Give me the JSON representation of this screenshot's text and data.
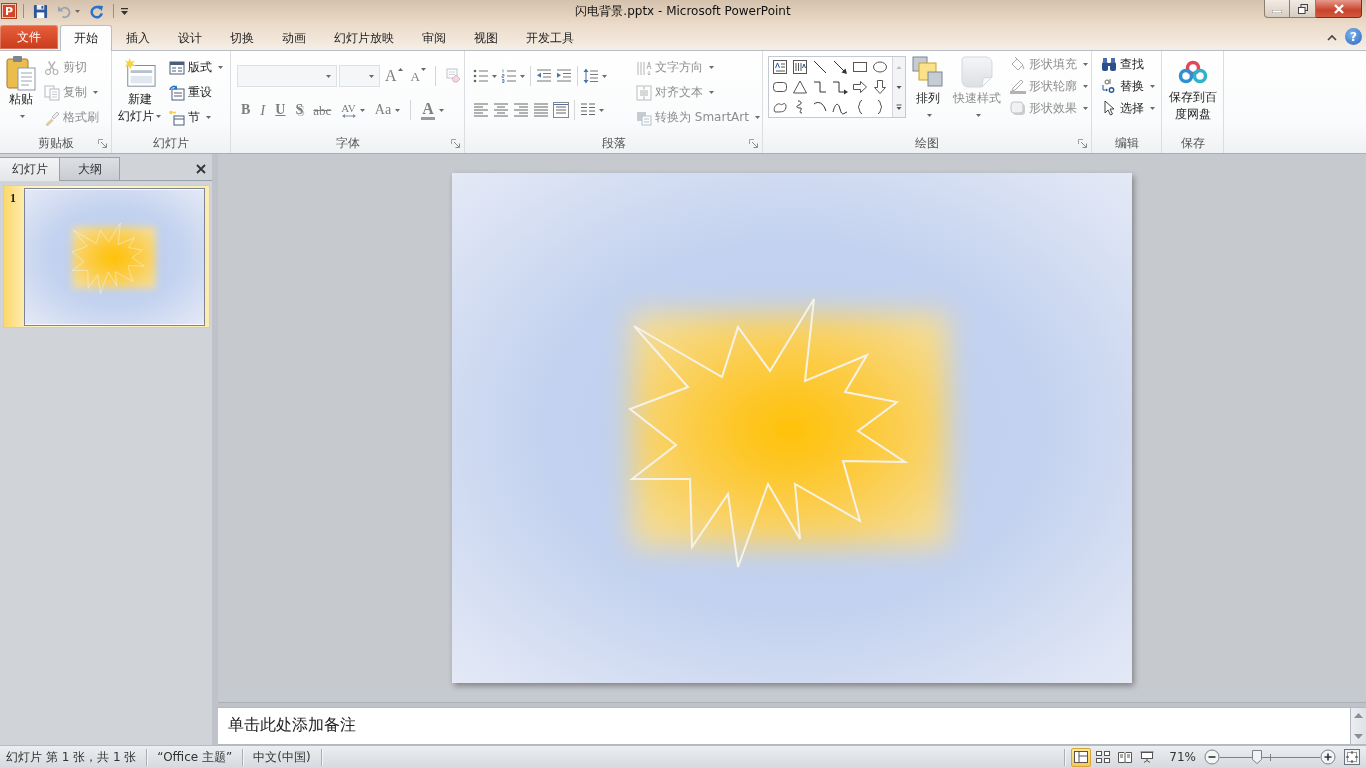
{
  "window": {
    "logo": "P",
    "title": "闪电背景.pptx - Microsoft PowerPoint",
    "help": "?"
  },
  "tabs": [
    {
      "label": "文件",
      "kind": "backstage",
      "selected": false
    },
    {
      "label": "开始",
      "kind": "tab",
      "selected": true
    },
    {
      "label": "插入",
      "kind": "tab",
      "selected": false
    },
    {
      "label": "设计",
      "kind": "tab",
      "selected": false
    },
    {
      "label": "切换",
      "kind": "tab",
      "selected": false
    },
    {
      "label": "动画",
      "kind": "tab",
      "selected": false
    },
    {
      "label": "幻灯片放映",
      "kind": "tab",
      "selected": false
    },
    {
      "label": "审阅",
      "kind": "tab",
      "selected": false
    },
    {
      "label": "视图",
      "kind": "tab",
      "selected": false
    },
    {
      "label": "开发工具",
      "kind": "tab",
      "selected": false
    }
  ],
  "ribbon": [
    {
      "label": "剪贴板",
      "launcher": true,
      "commands": [
        {
          "label": "粘贴",
          "disabled": false
        },
        {
          "label": "剪切",
          "disabled": true
        },
        {
          "label": "复制",
          "disabled": true
        },
        {
          "label": "格式刷",
          "disabled": true
        }
      ]
    },
    {
      "label": "幻灯片",
      "commands": [
        {
          "label": "新建",
          "label_2": "幻灯片",
          "disabled": false
        },
        {
          "label": "版式",
          "disabled": false
        },
        {
          "label": "重设",
          "disabled": false
        },
        {
          "label": "节",
          "disabled": false
        }
      ]
    },
    {
      "label": "字体",
      "launcher": true,
      "fields": [
        {
          "disabled": true
        },
        {
          "disabled": true
        }
      ],
      "commands": [
        {
          "label": "A",
          "kind": "grow",
          "disabled": true
        },
        {
          "label": "A",
          "kind": "shrink",
          "disabled": true
        },
        {
          "kind": "clear",
          "disabled": true
        },
        {
          "label": "B",
          "kind": "bold",
          "disabled": true
        },
        {
          "label": "I",
          "kind": "italic",
          "disabled": true
        },
        {
          "label": "U",
          "kind": "underline",
          "disabled": true
        },
        {
          "label": "S",
          "kind": "shadow",
          "disabled": true
        },
        {
          "label": "abc",
          "kind": "strike",
          "disabled": true
        },
        {
          "label": "AV",
          "kind": "spacing",
          "disabled": true
        },
        {
          "label": "Aa",
          "kind": "case",
          "disabled": true
        },
        {
          "label": "A",
          "kind": "color",
          "disabled": true
        }
      ]
    },
    {
      "label": "段落",
      "launcher": true,
      "commands": [
        {
          "label": "文字方向",
          "disabled": true
        },
        {
          "label": "对齐文本",
          "disabled": true
        },
        {
          "label": "转换为 SmartArt",
          "disabled": true
        }
      ]
    },
    {
      "label": "绘图",
      "launcher": true,
      "commands": [
        {
          "label": "排列",
          "disabled": false
        },
        {
          "label": "快速样式",
          "disabled": true
        },
        {
          "label": "形状填充",
          "disabled": true
        },
        {
          "label": "形状轮廓",
          "disabled": true
        },
        {
          "label": "形状效果",
          "disabled": true
        }
      ]
    },
    {
      "label": "编辑",
      "commands": [
        {
          "label": "查找",
          "disabled": false
        },
        {
          "label": "替换",
          "disabled": false
        },
        {
          "label": "选择",
          "disabled": false
        }
      ]
    },
    {
      "label": "保存",
      "commands": [
        {
          "label": "保存到百度网盘",
          "disabled": false
        }
      ]
    }
  ],
  "slide_panel": {
    "tabs": [
      {
        "label": "幻灯片",
        "selected": true
      },
      {
        "label": "大纲",
        "selected": false
      }
    ],
    "thumbnails": [
      {
        "number": "1",
        "selected": true
      }
    ]
  },
  "notes": {
    "placeholder": "单击此处添加备注"
  },
  "status_bar": {
    "items": [
      "幻灯片 第 1 张，共 1 张",
      "“Office 主题”",
      "中文(中国)"
    ],
    "views": [
      {
        "kind": "normal",
        "selected": true
      },
      {
        "kind": "sorter",
        "selected": false
      },
      {
        "kind": "reading",
        "selected": false
      },
      {
        "kind": "slideshow",
        "selected": false
      }
    ],
    "zoom": {
      "reading": "71%",
      "level": 0.36
    }
  }
}
